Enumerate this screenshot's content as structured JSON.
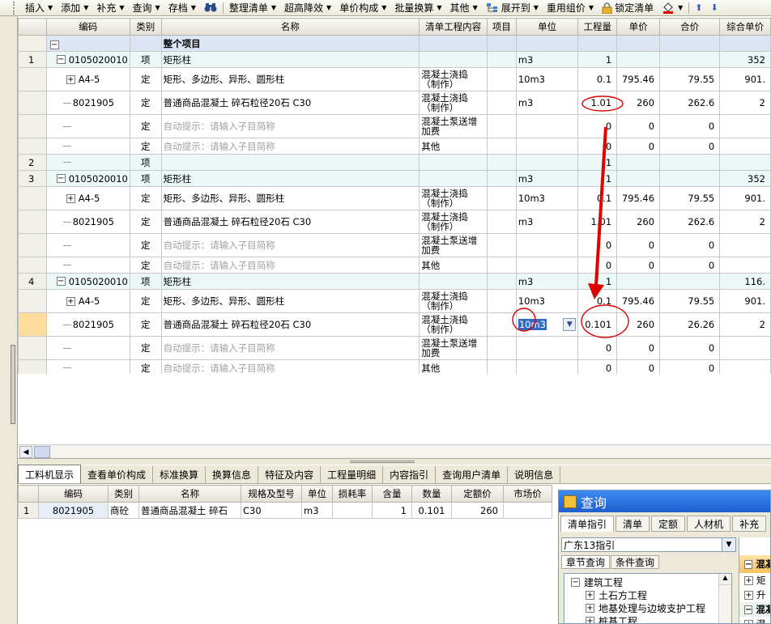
{
  "toolbar": {
    "items": [
      "插入",
      "添加",
      "补充",
      "查询",
      "存档",
      "整理清单",
      "超高降效",
      "单价构成",
      "批量换算",
      "其他",
      "展开到",
      "重用组价",
      "锁定清单"
    ]
  },
  "grid": {
    "headers": [
      "编码",
      "类别",
      "名称",
      "清单工程内容",
      "项目",
      "单位",
      "工程量",
      "单价",
      "合价",
      "综合单价"
    ],
    "group_label": "整个项目",
    "rows": [
      {
        "rownum": "1",
        "code": "0105020010",
        "type": "项",
        "name": "矩形柱",
        "content": "",
        "unit": "m3",
        "qty": "1",
        "price": "",
        "total": "",
        "comp": "352",
        "kind": "grp",
        "tree": "minus"
      },
      {
        "rownum": "",
        "code": "A4-5",
        "type": "定",
        "name": "矩形、多边形、异形、圆形柱",
        "content": "混凝土浇捣（制作）",
        "unit": "10m3",
        "qty": "0.1",
        "price": "795.46",
        "total": "79.55",
        "comp": "901.",
        "kind": "tall",
        "tree": "plus"
      },
      {
        "rownum": "",
        "code": "8021905",
        "type": "定",
        "name": "普通商品混凝土 碎石粒径20石 C30",
        "content": "混凝土浇捣（制作）",
        "unit": "m3",
        "qty": "1.01",
        "price": "260",
        "total": "262.6",
        "comp": "2",
        "kind": "tall",
        "tree": "line"
      },
      {
        "rownum": "",
        "code": "",
        "type": "定",
        "name": "自动提示：请输入子目简称",
        "content": "混凝土泵送增加费",
        "unit": "",
        "qty": "0",
        "price": "0",
        "total": "0",
        "comp": "",
        "kind": "tall",
        "tree": "line",
        "hint": true
      },
      {
        "rownum": "",
        "code": "",
        "type": "定",
        "name": "自动提示：请输入子目简称",
        "content": "其他",
        "unit": "",
        "qty": "0",
        "price": "0",
        "total": "0",
        "comp": "",
        "kind": "",
        "tree": "line",
        "hint": true
      },
      {
        "rownum": "2",
        "code": "",
        "type": "项",
        "name": "",
        "content": "",
        "unit": "",
        "qty": "1",
        "price": "",
        "total": "",
        "comp": "",
        "kind": "grp",
        "tree": "line"
      },
      {
        "rownum": "3",
        "code": "0105020010",
        "type": "项",
        "name": "矩形柱",
        "content": "",
        "unit": "m3",
        "qty": "1",
        "price": "",
        "total": "",
        "comp": "352",
        "kind": "grp",
        "tree": "minus"
      },
      {
        "rownum": "",
        "code": "A4-5",
        "type": "定",
        "name": "矩形、多边形、异形、圆形柱",
        "content": "混凝土浇捣（制作）",
        "unit": "10m3",
        "qty": "0.1",
        "price": "795.46",
        "total": "79.55",
        "comp": "901.",
        "kind": "tall",
        "tree": "plus"
      },
      {
        "rownum": "",
        "code": "8021905",
        "type": "定",
        "name": "普通商品混凝土 碎石粒径20石 C30",
        "content": "混凝土浇捣（制作）",
        "unit": "m3",
        "qty": "1.01",
        "price": "260",
        "total": "262.6",
        "comp": "2",
        "kind": "tall",
        "tree": "line"
      },
      {
        "rownum": "",
        "code": "",
        "type": "定",
        "name": "自动提示：请输入子目简称",
        "content": "混凝土泵送增加费",
        "unit": "",
        "qty": "0",
        "price": "0",
        "total": "0",
        "comp": "",
        "kind": "tall",
        "tree": "line",
        "hint": true
      },
      {
        "rownum": "",
        "code": "",
        "type": "定",
        "name": "自动提示：请输入子目简称",
        "content": "其他",
        "unit": "",
        "qty": "0",
        "price": "0",
        "total": "0",
        "comp": "",
        "kind": "",
        "tree": "line",
        "hint": true
      },
      {
        "rownum": "4",
        "code": "0105020010",
        "type": "项",
        "name": "矩形柱",
        "content": "",
        "unit": "m3",
        "qty": "1",
        "price": "",
        "total": "",
        "comp": "116.",
        "kind": "grp",
        "tree": "minus"
      },
      {
        "rownum": "",
        "code": "A4-5",
        "type": "定",
        "name": "矩形、多边形、异形、圆形柱",
        "content": "混凝土浇捣（制作）",
        "unit": "10m3",
        "qty": "0.1",
        "price": "795.46",
        "total": "79.55",
        "comp": "901.",
        "kind": "tall",
        "tree": "plus"
      },
      {
        "rownum": "",
        "code": "8021905",
        "type": "定",
        "name": "普通商品混凝土 碎石粒径20石 C30",
        "content": "混凝土浇捣（制作）",
        "unit": "10m3",
        "qty": "0.101",
        "price": "260",
        "total": "26.26",
        "comp": "2",
        "kind": "tall sel",
        "tree": "line",
        "editing": true
      },
      {
        "rownum": "",
        "code": "",
        "type": "定",
        "name": "自动提示：请输入子目简称",
        "content": "混凝土泵送增加费",
        "unit": "",
        "qty": "0",
        "price": "0",
        "total": "0",
        "comp": "",
        "kind": "tall",
        "tree": "line",
        "hint": true
      },
      {
        "rownum": "",
        "code": "",
        "type": "定",
        "name": "自动提示：请输入子目简称",
        "content": "其他",
        "unit": "",
        "qty": "0",
        "price": "0",
        "total": "0",
        "comp": "",
        "kind": "",
        "tree": "line",
        "hint": true
      }
    ]
  },
  "bottom_tabs": [
    "工料机显示",
    "查看单价构成",
    "标准换算",
    "换算信息",
    "特征及内容",
    "工程量明细",
    "内容指引",
    "查询用户清单",
    "说明信息"
  ],
  "bottom_grid": {
    "headers": [
      "编码",
      "类别",
      "名称",
      "规格及型号",
      "单位",
      "损耗率",
      "含量",
      "数量",
      "定额价",
      "市场价"
    ],
    "row": {
      "rownum": "1",
      "code": "8021905",
      "type": "商砼",
      "name": "普通商品混凝土 碎石",
      "spec": "C30",
      "unit": "m3",
      "loss": "",
      "content": "1",
      "qty": "0.101",
      "price": "260",
      "market": ""
    }
  },
  "query_panel": {
    "title": "查询",
    "tabs": [
      "清单指引",
      "清单",
      "定额",
      "人材机",
      "补充"
    ],
    "select_value": "广东13指引",
    "sub_tabs": [
      "章节查询",
      "条件查询"
    ],
    "tree": [
      "建筑工程",
      "土石方工程",
      "地基处理与边坡支护工程",
      "桩基工程"
    ],
    "right_items": [
      "混凝",
      "矩",
      "升",
      "混凝",
      "混"
    ]
  }
}
